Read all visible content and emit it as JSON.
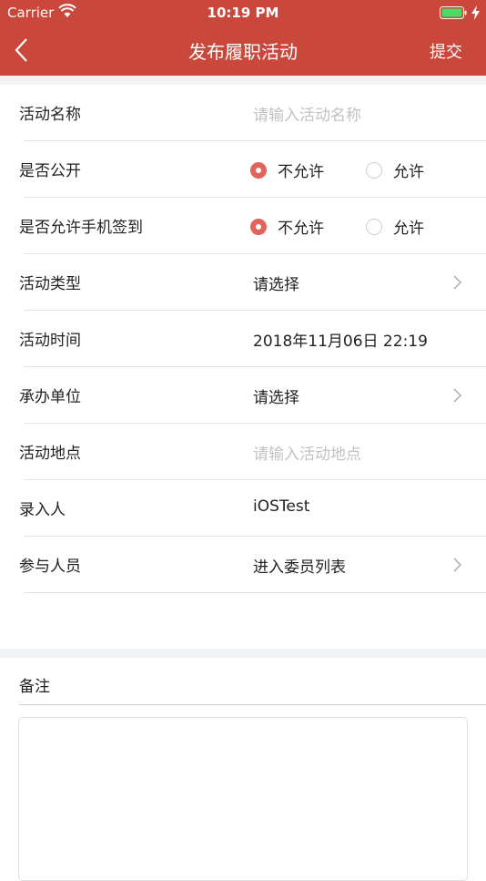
{
  "status_bar": {
    "carrier": "Carrier",
    "time": "10:19 PM"
  },
  "nav": {
    "title": "发布履职活动",
    "submit_label": "提交"
  },
  "form": {
    "activity_name": {
      "label": "活动名称",
      "placeholder": "请输入活动名称"
    },
    "is_public": {
      "label": "是否公开",
      "options": [
        "不允许",
        "允许"
      ],
      "selected": "不允许"
    },
    "phone_checkin": {
      "label": "是否允许手机签到",
      "options": [
        "不允许",
        "允许"
      ],
      "selected": "不允许"
    },
    "activity_type": {
      "label": "活动类型",
      "value": "请选择"
    },
    "activity_time": {
      "label": "活动时间",
      "value": "2018年11月06日 22:19"
    },
    "organizer": {
      "label": "承办单位",
      "value": "请选择"
    },
    "location": {
      "label": "活动地点",
      "placeholder": "请输入活动地点"
    },
    "recorder": {
      "label": "录入人",
      "value": "iOSTest"
    },
    "participants": {
      "label": "参与人员",
      "value": "进入委员列表"
    }
  },
  "remarks": {
    "label": "备注"
  },
  "colors": {
    "header_bg": "#c9473b",
    "radio_checked": "#e0645c",
    "placeholder": "#c2c2c2"
  }
}
